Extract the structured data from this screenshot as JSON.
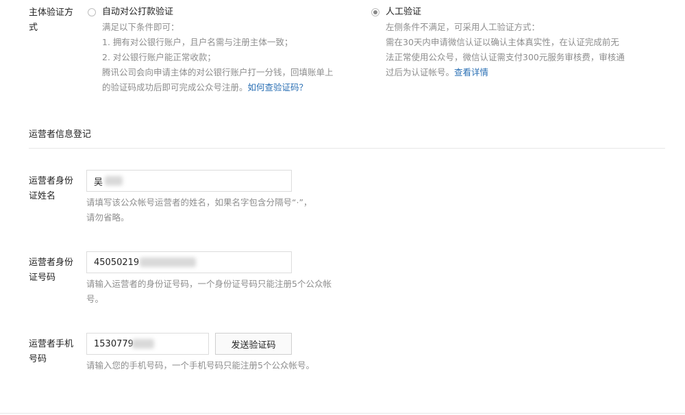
{
  "verify_method": {
    "label": "主体验证方式",
    "auto": {
      "title": "自动对公打款验证",
      "selected": false,
      "lines": [
        "满足以下条件即可：",
        "1. 拥有对公银行账户，且户名需与注册主体一致；",
        "2. 对公银行账户能正常收款；",
        "腾讯公司会向申请主体的对公银行账户打一分钱，回填账单上",
        "的验证码成功后即可完成公众号注册。"
      ],
      "link": "如何查验证码？"
    },
    "manual": {
      "title": "人工验证",
      "selected": true,
      "lines": [
        "左侧条件不满足，可采用人工验证方式：",
        "需在30天内申请微信认证以确认主体真实性，在认证完成前无",
        "法正常使用公众号，微信认证需支付300元服务审核费，审核通",
        "过后为认证帐号。"
      ],
      "link": "查看详情"
    }
  },
  "operator_section": {
    "title": "运营者信息登记"
  },
  "fields": {
    "name": {
      "label": "运营者身份证姓名",
      "value": "吴",
      "hint": "请填写该公众帐号运营者的姓名，如果名字包含分隔号“·”，请勿省略。"
    },
    "id_number": {
      "label": "运营者身份证号码",
      "value": "45050219",
      "hint": "请输入运营者的身份证号码，一个身份证号码只能注册5个公众帐号。"
    },
    "phone": {
      "label": "运营者手机号码",
      "value": "1530779",
      "hint": "请输入您的手机号码，一个手机号码只能注册5个公众帐号。",
      "send_button": "发送验证码"
    }
  }
}
